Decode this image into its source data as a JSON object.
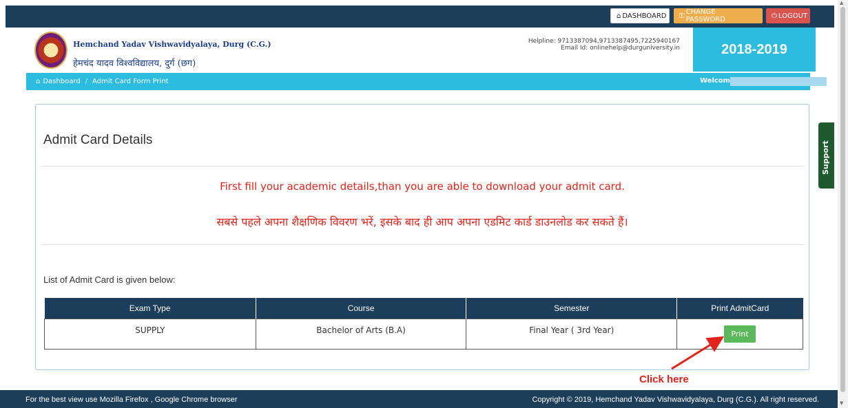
{
  "topbar": {
    "dashboard_label": "DASHBOARD",
    "change_password_label": "CHANGE PASSWORD",
    "logout_label": "LOGOUT"
  },
  "header": {
    "university_en": "Hemchand Yadav Vishwavidyalaya, Durg (C.G.)",
    "university_hi": "हेमचंद यादव विश्वविद्यालय, दुर्ग (छग)",
    "helpline": "Helpline: 9713387094,9713387495,7225940167",
    "email": "Email Id: onlinehelp@durguniversity.in",
    "session_year": "2018-2019"
  },
  "breadcrumb": {
    "home": "Dashboard",
    "current": "Admit Card Form Print",
    "welcome": "Welcome :"
  },
  "panel": {
    "title": "Admit Card Details",
    "message_en": "First fill your academic details,than you are able to download your admit card.",
    "message_hi": "सबसे पहले अपना शैक्षणिक विवरण भरें, इसके बाद ही आप अपना एडमिट कार्ड डाउनलोड कर सकते हैं।",
    "list_label": "List of Admit Card is given below:"
  },
  "table": {
    "headers": [
      "Exam Type",
      "Course",
      "Semester",
      "Print AdmitCard"
    ],
    "rows": [
      {
        "exam_type": "SUPPLY",
        "course": "Bachelor of Arts (B.A)",
        "semester": "Final Year ( 3rd Year)",
        "action": "Print"
      }
    ]
  },
  "annotation": {
    "click_here": "Click here",
    "color": "#e2231a"
  },
  "support_label": "Support",
  "footer": {
    "left": "For the best view use Mozilla Firefox , Google Chrome browser",
    "right": "Copyright © 2019, Hemchand Yadav Vishwavidyalaya, Durg (C.G.). All right reserved."
  },
  "colors": {
    "navy": "#1c3e5a",
    "cyan": "#2bbce0",
    "orange": "#f0ad4e",
    "danger": "#d9534f",
    "success": "#5cb85c"
  }
}
